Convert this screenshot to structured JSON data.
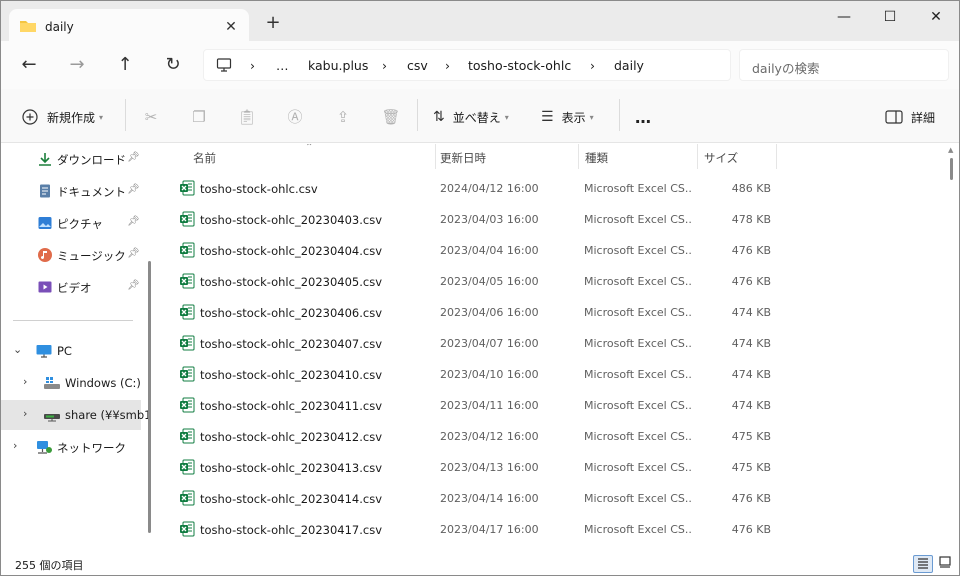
{
  "tab": {
    "title": "daily",
    "close": "✕",
    "new_tab": "+"
  },
  "window_controls": {
    "minimize": "—",
    "maximize": "☐",
    "close": "✕"
  },
  "nav": {
    "back": "←",
    "forward": "→",
    "up": "↑",
    "refresh": "↻"
  },
  "address": {
    "overflow": "…",
    "segments": [
      "kabu.plus",
      "csv",
      "tosho-stock-ohlc",
      "daily"
    ],
    "separator": "›"
  },
  "search": {
    "placeholder": "dailyの検索"
  },
  "toolbar": {
    "new_label": "新規作成",
    "sort_label": "並べ替え",
    "view_label": "表示",
    "more_label": "…",
    "details_label": "詳細"
  },
  "sidebar": {
    "quick": [
      {
        "label": "ダウンロード",
        "icon": "download-icon"
      },
      {
        "label": "ドキュメント",
        "icon": "document-icon"
      },
      {
        "label": "ピクチャ",
        "icon": "pictures-icon"
      },
      {
        "label": "ミュージック",
        "icon": "music-icon"
      },
      {
        "label": "ビデオ",
        "icon": "video-icon"
      }
    ],
    "pc_label": "PC",
    "drives": [
      {
        "label": "Windows (C:)",
        "icon": "windows-drive-icon"
      },
      {
        "label": "share (¥¥smb1",
        "icon": "network-drive-icon"
      }
    ],
    "network_label": "ネットワーク"
  },
  "columns": {
    "name": "名前",
    "date": "更新日時",
    "type": "種類",
    "size": "サイズ"
  },
  "files": [
    {
      "name": "tosho-stock-ohlc.csv",
      "date": "2024/04/12 16:00",
      "type": "Microsoft Excel CS...",
      "size": "486 KB"
    },
    {
      "name": "tosho-stock-ohlc_20230403.csv",
      "date": "2023/04/03 16:00",
      "type": "Microsoft Excel CS...",
      "size": "478 KB"
    },
    {
      "name": "tosho-stock-ohlc_20230404.csv",
      "date": "2023/04/04 16:00",
      "type": "Microsoft Excel CS...",
      "size": "476 KB"
    },
    {
      "name": "tosho-stock-ohlc_20230405.csv",
      "date": "2023/04/05 16:00",
      "type": "Microsoft Excel CS...",
      "size": "476 KB"
    },
    {
      "name": "tosho-stock-ohlc_20230406.csv",
      "date": "2023/04/06 16:00",
      "type": "Microsoft Excel CS...",
      "size": "474 KB"
    },
    {
      "name": "tosho-stock-ohlc_20230407.csv",
      "date": "2023/04/07 16:00",
      "type": "Microsoft Excel CS...",
      "size": "474 KB"
    },
    {
      "name": "tosho-stock-ohlc_20230410.csv",
      "date": "2023/04/10 16:00",
      "type": "Microsoft Excel CS...",
      "size": "474 KB"
    },
    {
      "name": "tosho-stock-ohlc_20230411.csv",
      "date": "2023/04/11 16:00",
      "type": "Microsoft Excel CS...",
      "size": "474 KB"
    },
    {
      "name": "tosho-stock-ohlc_20230412.csv",
      "date": "2023/04/12 16:00",
      "type": "Microsoft Excel CS...",
      "size": "475 KB"
    },
    {
      "name": "tosho-stock-ohlc_20230413.csv",
      "date": "2023/04/13 16:00",
      "type": "Microsoft Excel CS...",
      "size": "475 KB"
    },
    {
      "name": "tosho-stock-ohlc_20230414.csv",
      "date": "2023/04/14 16:00",
      "type": "Microsoft Excel CS...",
      "size": "476 KB"
    },
    {
      "name": "tosho-stock-ohlc_20230417.csv",
      "date": "2023/04/17 16:00",
      "type": "Microsoft Excel CS...",
      "size": "476 KB"
    }
  ],
  "status": {
    "item_count": "255 個の項目"
  },
  "colors": {
    "accent": "#0067c0",
    "excel_green": "#107c41",
    "folder_yellow": "#f4c542"
  }
}
